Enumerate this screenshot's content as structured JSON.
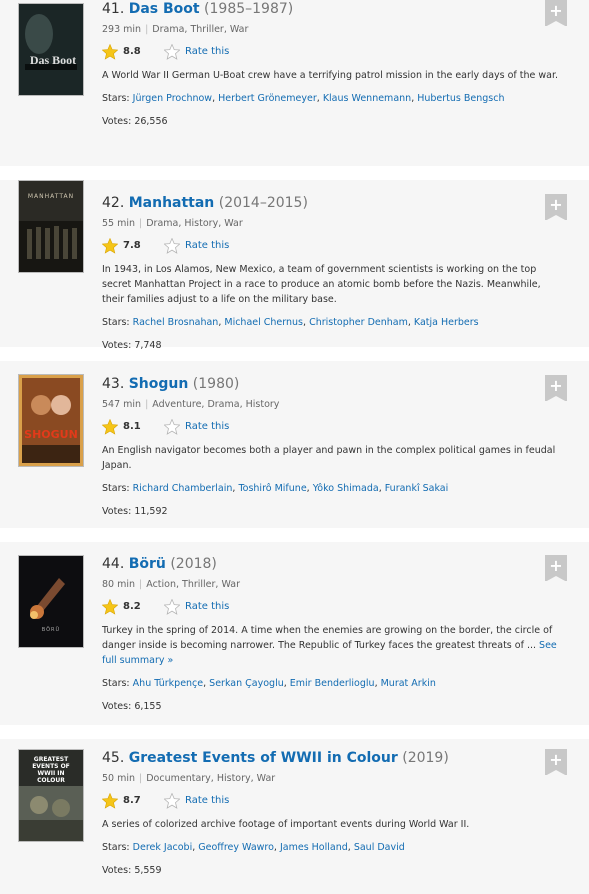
{
  "rate_label": "Rate this",
  "stars_label": "Stars:",
  "votes_label": "Votes:",
  "items": [
    {
      "number": "41.",
      "title": "Das Boot",
      "year": "(1985–1987)",
      "runtime": "293 min",
      "genres": "Drama, Thriller, War",
      "rating": "8.8",
      "description": "A World War II German U-Boat crew have a terrifying patrol mission in the early days of the war.",
      "more": "",
      "stars": [
        "Jürgen Prochnow",
        "Herbert Grönemeyer",
        "Klaus Wennemann",
        "Hubertus Bengsch"
      ],
      "votes": "26,556",
      "poster_text": "Das Boot"
    },
    {
      "number": "42.",
      "title": "Manhattan",
      "year": "(2014–2015)",
      "runtime": "55 min",
      "genres": "Drama, History, War",
      "rating": "7.8",
      "description": "In 1943, in Los Alamos, New Mexico, a team of government scientists is working on the top secret Manhattan Project in a race to produce an atomic bomb before the Nazis. Meanwhile, their families adjust to a life on the military base.",
      "more": "",
      "stars": [
        "Rachel Brosnahan",
        "Michael Chernus",
        "Christopher Denham",
        "Katja Herbers"
      ],
      "votes": "7,748",
      "poster_text": "MANHATTAN"
    },
    {
      "number": "43.",
      "title": "Shogun",
      "year": "(1980)",
      "runtime": "547 min",
      "genres": "Adventure, Drama, History",
      "rating": "8.1",
      "description": "An English navigator becomes both a player and pawn in the complex political games in feudal Japan.",
      "more": "",
      "stars": [
        "Richard Chamberlain",
        "Toshirô Mifune",
        "Yôko Shimada",
        "Furankî Sakai"
      ],
      "votes": "11,592",
      "poster_text": "SHOGUN"
    },
    {
      "number": "44.",
      "title": "Börü",
      "year": "(2018)",
      "runtime": "80 min",
      "genres": "Action, Thriller, War",
      "rating": "8.2",
      "description": "Turkey in the spring of 2014. A time when the enemies are growing on the border, the circle of danger inside is becoming narrower. The Republic of Turkey faces the greatest threats of ...",
      "more": "See full summary »",
      "stars": [
        "Ahu Türkpençe",
        "Serkan Çayoglu",
        "Emir Benderlioglu",
        "Murat Arkin"
      ],
      "votes": "6,155",
      "poster_text": "BÖRÜ"
    },
    {
      "number": "45.",
      "title": "Greatest Events of WWII in Colour",
      "year": "(2019)",
      "runtime": "50 min",
      "genres": "Documentary, History, War",
      "rating": "8.7",
      "description": "A series of colorized archive footage of important events during World War II.",
      "more": "",
      "stars": [
        "Derek Jacobi",
        "Geoffrey Wawro",
        "James Holland",
        "Saul David"
      ],
      "votes": "5,559",
      "poster_text": "GREATEST EVENTS OF WWII IN COLOUR"
    }
  ]
}
